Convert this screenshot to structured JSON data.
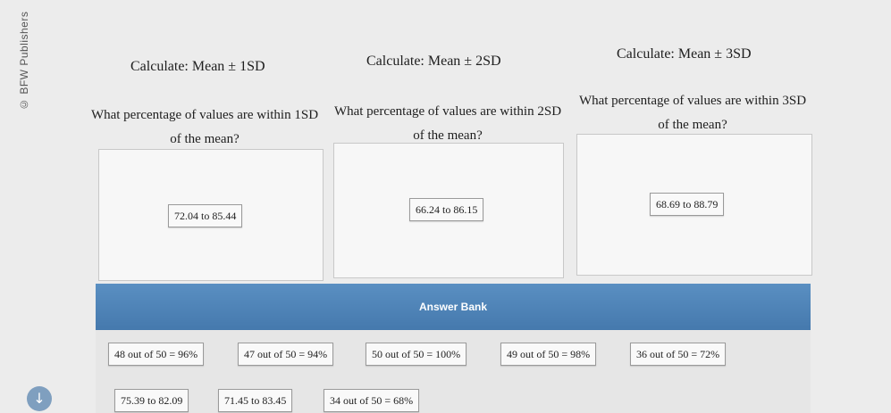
{
  "watermark": "© BFW Publishers",
  "columns": [
    {
      "calc_label": "Calculate: Mean ± 1SD",
      "question": "What percentage of values are within 1SD of the mean?",
      "placed_answer": "72.04 to 85.44"
    },
    {
      "calc_label": "Calculate: Mean ± 2SD",
      "question": "What percentage of values are within 2SD of the mean?",
      "placed_answer": "66.24 to 86.15"
    },
    {
      "calc_label": "Calculate: Mean ± 3SD",
      "question": "What percentage of values are within 3SD of the mean?",
      "placed_answer": "68.69 to 88.79"
    }
  ],
  "answer_bank": {
    "title": "Answer Bank",
    "items": [
      "48 out of 50 = 96%",
      "47 out of 50 = 94%",
      "50 out of 50 = 100%",
      "49 out of 50 = 98%",
      "36 out of 50 = 72%",
      "75.39 to 82.09",
      "71.45 to 83.45",
      "34 out of 50 = 68%"
    ]
  },
  "scroll_icon": "down-arrow-icon",
  "colors": {
    "bank_header": "#4f84b8",
    "background": "#ececec"
  }
}
